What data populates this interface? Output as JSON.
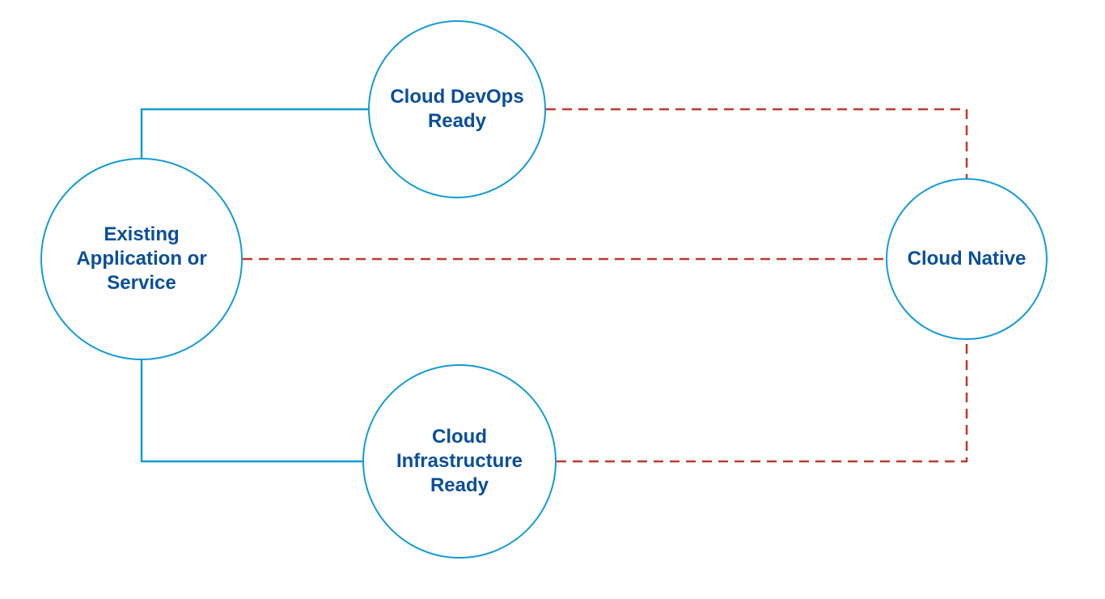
{
  "colors": {
    "circleStroke": "#149bd7",
    "labelText": "#0a4f9a",
    "solidLine": "#149bd7",
    "dashedLine": "#c0392b"
  },
  "nodes": {
    "left": {
      "label": "Existing Application or Service"
    },
    "top": {
      "label": "Cloud DevOps Ready"
    },
    "bottom": {
      "label": "Cloud Infrastructure Ready"
    },
    "right": {
      "label": "Cloud Native"
    }
  },
  "edges": [
    {
      "from": "left",
      "to": "top",
      "style": "solid"
    },
    {
      "from": "left",
      "to": "bottom",
      "style": "solid"
    },
    {
      "from": "left",
      "to": "right",
      "style": "dashed"
    },
    {
      "from": "top",
      "to": "right",
      "style": "dashed"
    },
    {
      "from": "bottom",
      "to": "right",
      "style": "dashed"
    }
  ]
}
